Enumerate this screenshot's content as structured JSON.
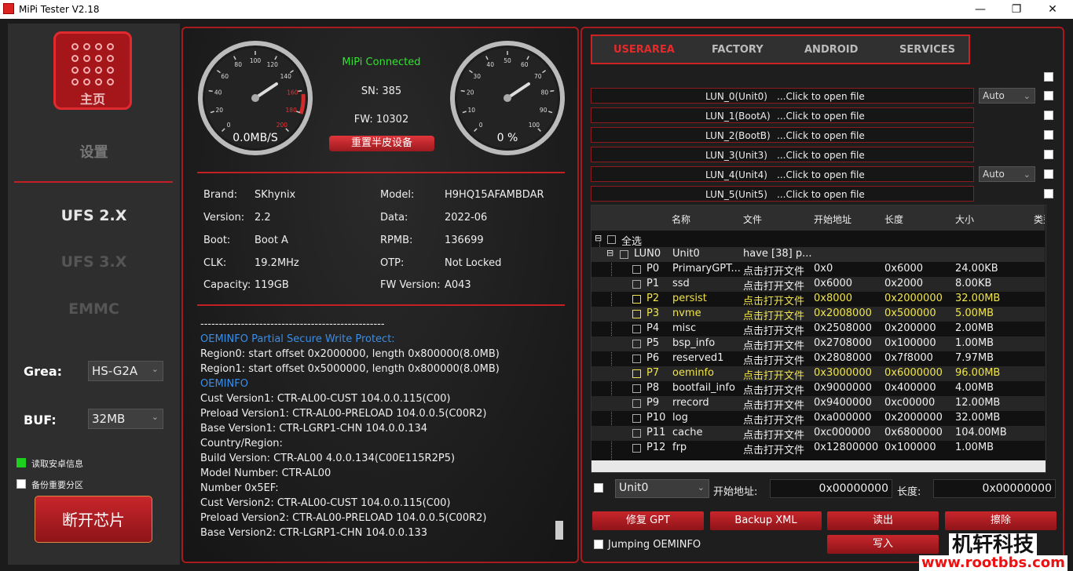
{
  "window": {
    "title": "MiPi Tester V2.18",
    "min": "—",
    "max": "❐",
    "close": "✕"
  },
  "sidebar": {
    "logo_label": "主页",
    "settings": "设置",
    "modes": [
      "UFS 2.X",
      "UFS 3.X",
      "EMMC"
    ],
    "grea_label": "Grea:",
    "grea_value": "HS-G2A",
    "buf_label": "BUF:",
    "buf_value": "32MB",
    "read_android_info": "读取安卓信息",
    "backup_important": "备份重要分区",
    "disconnect": "断开芯片"
  },
  "gauges": {
    "speed_value": "0.0MB/S",
    "speed_ticks": [
      "0",
      "20",
      "40",
      "60",
      "80",
      "100",
      "120",
      "140",
      "160",
      "180",
      "200"
    ],
    "percent_value": "0 %",
    "percent_ticks": [
      "0",
      "10",
      "20",
      "30",
      "40",
      "50",
      "60",
      "70",
      "80",
      "90",
      "100"
    ],
    "status": "MiPi Connected",
    "sn": "SN: 385",
    "fw": "FW: 10302",
    "reset_button": "重置半皮设备",
    "status_color": "#34e134"
  },
  "device": {
    "brand_label": "Brand:",
    "brand": "SKhynix",
    "version_label": "Version:",
    "version": "2.2",
    "boot_label": "Boot:",
    "boot": "Boot A",
    "clk_label": "CLK:",
    "clk": "19.2MHz",
    "capacity_label": "Capacity:",
    "capacity": "119GB",
    "model_label": "Model:",
    "model": "H9HQ15AFAMBDAR",
    "data_label": "Data:",
    "data": "2022-06",
    "rpmb_label": "RPMB:",
    "rpmb": "136699",
    "otp_label": "OTP:",
    "otp": "Not Locked",
    "fwver_label": "FW Version:",
    "fwver": "A043"
  },
  "log": [
    {
      "text": "--------------------------------------------------",
      "blue": false
    },
    {
      "text": "OEMINFO Partial Secure Write Protect:",
      "blue": true
    },
    {
      "text": "Region0: start offset 0x2000000, length 0x800000(8.0MB)",
      "blue": false
    },
    {
      "text": "Region1: start offset 0x5000000, length 0x800000(8.0MB)",
      "blue": false
    },
    {
      "text": "OEMINFO",
      "blue": true
    },
    {
      "text": "Cust Version1: CTR-AL00-CUST 104.0.0.115(C00)",
      "blue": false
    },
    {
      "text": "Preload Version1: CTR-AL00-PRELOAD 104.0.0.5(C00R2)",
      "blue": false
    },
    {
      "text": "Base Version1: CTR-LGRP1-CHN 104.0.0.134",
      "blue": false
    },
    {
      "text": "Country/Region:",
      "blue": false
    },
    {
      "text": "Build Version: CTR-AL00 4.0.0.134(C00E115R2P5)",
      "blue": false
    },
    {
      "text": "Model Number: CTR-AL00",
      "blue": false
    },
    {
      "text": "Number 0x5EF:",
      "blue": false
    },
    {
      "text": "Cust Version2: CTR-AL00-CUST 104.0.0.115(C00)",
      "blue": false
    },
    {
      "text": "Preload Version2: CTR-AL00-PRELOAD 104.0.0.5(C00R2)",
      "blue": false
    },
    {
      "text": "Base Version2: CTR-LGRP1-CHN 104.0.0.133",
      "blue": false
    }
  ],
  "tabs": [
    "USERAREA",
    "FACTORY",
    "ANDROID",
    "SERVICES"
  ],
  "luns": [
    {
      "name": "LUN_0(Unit0)",
      "click": "...Click to open file",
      "auto": "Auto"
    },
    {
      "name": "LUN_1(BootA)",
      "click": "...Click to open file",
      "auto": ""
    },
    {
      "name": "LUN_2(BootB)",
      "click": "...Click to open file",
      "auto": ""
    },
    {
      "name": "LUN_3(Unit3)",
      "click": "...Click to open file",
      "auto": ""
    },
    {
      "name": "LUN_4(Unit4)",
      "click": "...Click to open file",
      "auto": "Auto"
    },
    {
      "name": "LUN_5(Unit5)",
      "click": "...Click to open file",
      "auto": ""
    }
  ],
  "table": {
    "headers": [
      "名称",
      "文件",
      "开始地址",
      "长度",
      "大小",
      "类型"
    ],
    "select_all": "全选",
    "lun0_id": "LUN0",
    "lun0_name": "Unit0",
    "lun0_file": "have [38] p...",
    "rows": [
      {
        "id": "P0",
        "name": "PrimaryGPT...",
        "file": "点击打开文件",
        "start": "0x0",
        "len": "0x6000",
        "size": "24.00KB",
        "hl": false
      },
      {
        "id": "P1",
        "name": "ssd",
        "file": "点击打开文件",
        "start": "0x6000",
        "len": "0x2000",
        "size": "8.00KB",
        "hl": false
      },
      {
        "id": "P2",
        "name": "persist",
        "file": "点击打开文件",
        "start": "0x8000",
        "len": "0x2000000",
        "size": "32.00MB",
        "hl": true
      },
      {
        "id": "P3",
        "name": "nvme",
        "file": "点击打开文件",
        "start": "0x2008000",
        "len": "0x500000",
        "size": "5.00MB",
        "hl": true
      },
      {
        "id": "P4",
        "name": "misc",
        "file": "点击打开文件",
        "start": "0x2508000",
        "len": "0x200000",
        "size": "2.00MB",
        "hl": false
      },
      {
        "id": "P5",
        "name": "bsp_info",
        "file": "点击打开文件",
        "start": "0x2708000",
        "len": "0x100000",
        "size": "1.00MB",
        "hl": false
      },
      {
        "id": "P6",
        "name": "reserved1",
        "file": "点击打开文件",
        "start": "0x2808000",
        "len": "0x7f8000",
        "size": "7.97MB",
        "hl": false
      },
      {
        "id": "P7",
        "name": "oeminfo",
        "file": "点击打开文件",
        "start": "0x3000000",
        "len": "0x6000000",
        "size": "96.00MB",
        "hl": true
      },
      {
        "id": "P8",
        "name": "bootfail_info",
        "file": "点击打开文件",
        "start": "0x9000000",
        "len": "0x400000",
        "size": "4.00MB",
        "hl": false
      },
      {
        "id": "P9",
        "name": "rrecord",
        "file": "点击打开文件",
        "start": "0x9400000",
        "len": "0xc00000",
        "size": "12.00MB",
        "hl": false
      },
      {
        "id": "P10",
        "name": "log",
        "file": "点击打开文件",
        "start": "0xa000000",
        "len": "0x2000000",
        "size": "32.00MB",
        "hl": false
      },
      {
        "id": "P11",
        "name": "cache",
        "file": "点击打开文件",
        "start": "0xc000000",
        "len": "0x6800000",
        "size": "104.00MB",
        "hl": false
      },
      {
        "id": "P12",
        "name": "frp",
        "file": "点击打开文件",
        "start": "0x12800000",
        "len": "0x100000",
        "size": "1.00MB",
        "hl": false
      }
    ]
  },
  "bottom": {
    "unit_value": "Unit0",
    "start_label": "开始地址:",
    "start_value": "0x00000000",
    "len_label": "长度:",
    "len_value": "0x00000000",
    "btn_fix_gpt": "修复 GPT",
    "btn_backup_xml": "Backup XML",
    "btn_read": "读出",
    "btn_erase": "擦除",
    "btn_write": "写入",
    "jumping": "Jumping OEMINFO"
  },
  "watermark": {
    "cn": "机轩科技",
    "url": "www.rootbbs.com"
  }
}
